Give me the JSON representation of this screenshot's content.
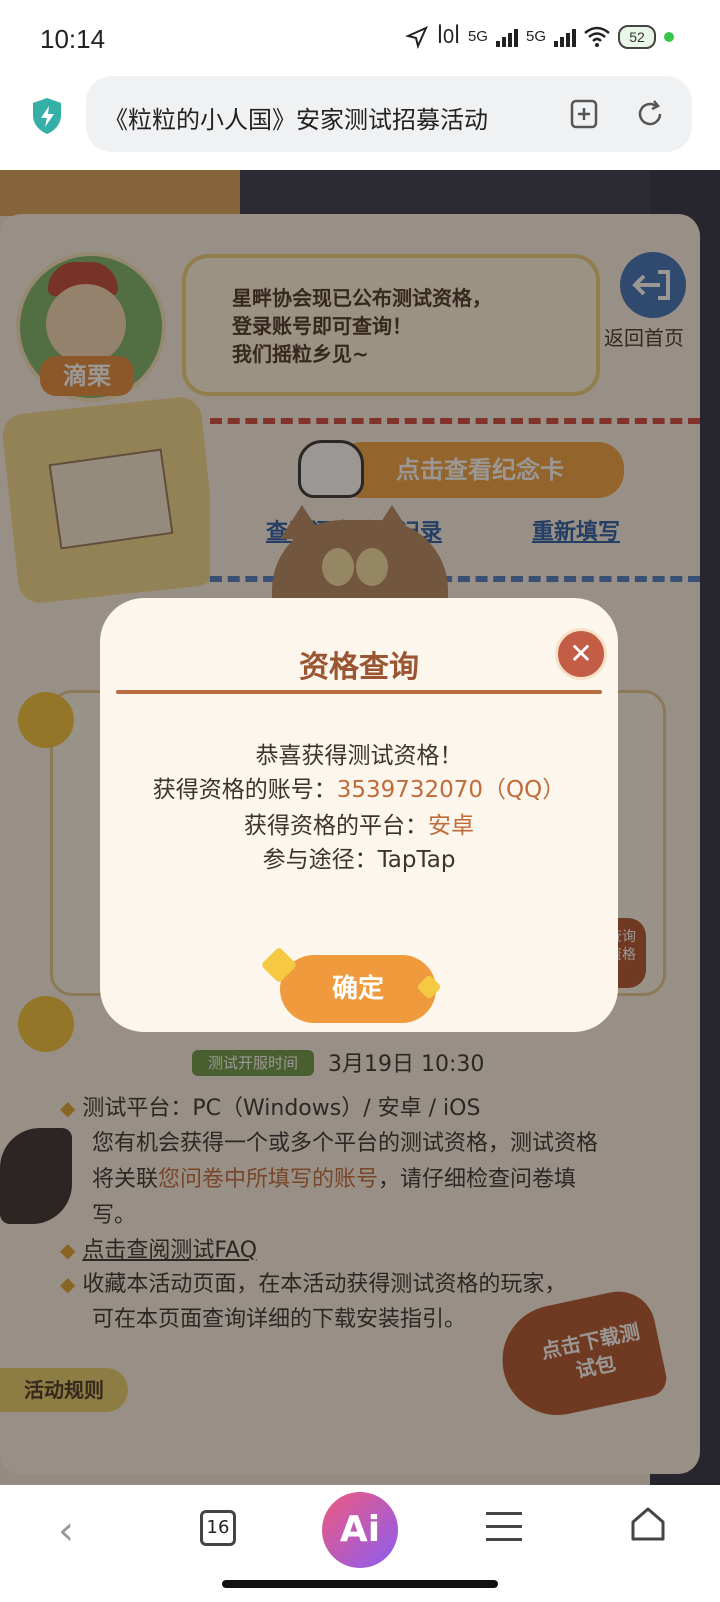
{
  "status_bar": {
    "time": "10:14",
    "network_1": "5G",
    "network_2": "5G",
    "battery": "52",
    "dot_color": "#37c64a"
  },
  "browser": {
    "url_title": "《粒粒的小人国》安家测试招募活动",
    "tab_count": "16",
    "ai_label": "Ai"
  },
  "page": {
    "avatar_name": "滴栗",
    "bubble_lines": [
      "星畔协会现已公布测试资格，",
      "登录账号即可查询！",
      "我们摇粒乡见~"
    ],
    "back_home": "返回首页",
    "memorial_card_button": "点击查看纪念卡",
    "view_record_link": "查看问卷填写记录",
    "refill_link": "重新填写",
    "test_open_tag": "测试开服时间",
    "test_open_value": "3月19日  10:30",
    "bullet_platform": "测试平台：PC（Windows）/ 安卓 / iOS",
    "bullet_qualify_1": "您有机会获得一个或多个平台的测试资格，测试资格",
    "bullet_qualify_2_prefix": "将关联",
    "bullet_qualify_2_highlight": "您问卷中所填写的账号",
    "bullet_qualify_2_suffix": "，请仔细检查问卷填",
    "bullet_qualify_3": "写。",
    "faq_link": "点击查阅测试FAQ",
    "bullet_save_1": "收藏本活动页面，在本活动获得测试资格的玩家，",
    "bullet_save_2": "可在本页面查询详细的下载安装指引。",
    "rules_tab": "活动规则",
    "download_button": "点击下载测试包",
    "side_button": "查询资格"
  },
  "dialog": {
    "title": "资格查询",
    "congrats": "恭喜获得测试资格！",
    "account_label": "获得资格的账号：",
    "account_value": "3539732070（QQ）",
    "platform_label": "获得资格的平台：",
    "platform_value": "安卓",
    "channel_label": "参与途径：",
    "channel_value": "TapTap",
    "confirm_button": "确定",
    "close_glyph": "✕"
  },
  "colors": {
    "accent_orange": "#ef9a3c",
    "dialog_title": "#9a5632",
    "highlight": "#c06b3a",
    "link_blue": "#2b5da8"
  }
}
